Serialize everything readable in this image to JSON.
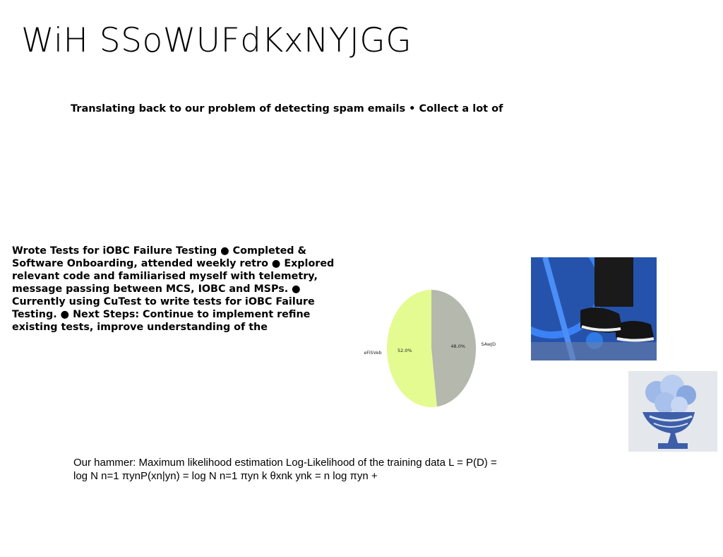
{
  "slide": {
    "title": "WiH SSoWUFdKxNYJGG",
    "subtitle": "Translating back to our problem of detecting spam emails • Collect a lot of",
    "body": "Wrote Tests for iOBC Failure Testing ● Completed & Software Onboarding, attended weekly retro ● Explored relevant code and familiarised myself with telemetry, message passing between MCS, IOBC and MSPs. ● Currently using CuTest to write tests for iOBC Failure Testing. ● Next Steps: Continue to implement refine existing tests, improve understanding of the",
    "formula": "Our hammer: Maximum likelihood estimation Log-Likelihood of the training data L = P(D) = log N  n=1 πynP(xn|yn) = log N  n=1  πyn  k θxnk ynk  =  n  log πyn +"
  },
  "images": {
    "bike_photo": "bike-photo",
    "vase_photo": "flower-vase-photo"
  },
  "chart_data": {
    "type": "pie",
    "labels": [
      "SAwJD",
      "eFiSVeb"
    ],
    "values": [
      48.0,
      52.0
    ],
    "value_labels": [
      "48.0%",
      "52.0%"
    ],
    "colors": [
      "#b4b8ad",
      "#e3fb90"
    ],
    "start_angle": 90,
    "direction": "clockwise"
  }
}
